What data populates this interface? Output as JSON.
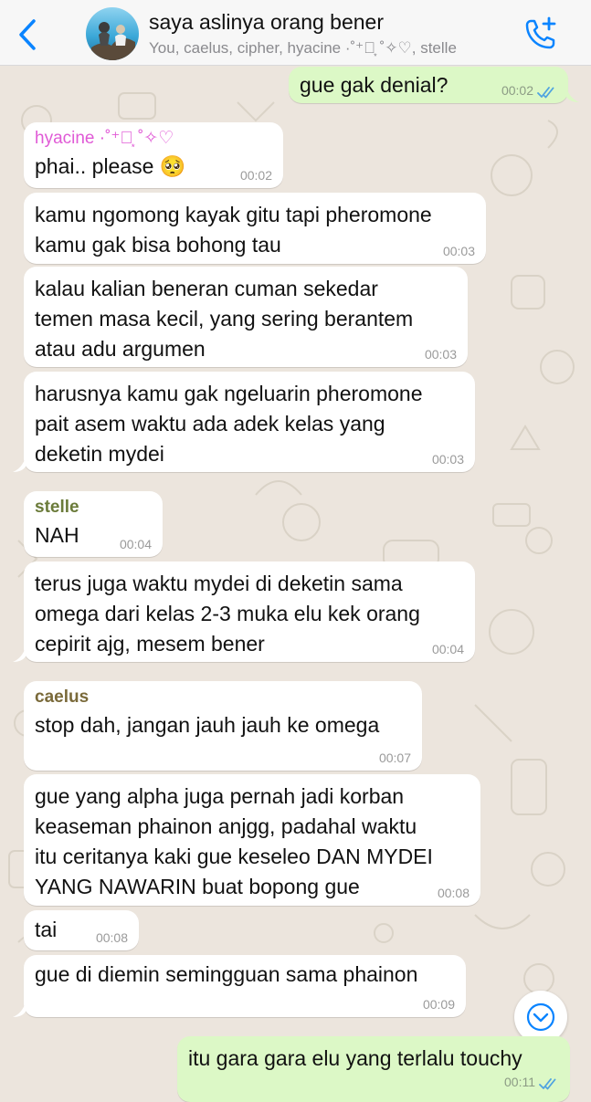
{
  "header": {
    "title": "saya aslinya orang bener",
    "members": "You, caelus, cipher, hyacine ·˚⁺‧͙ ˚✧♡, stelle",
    "back_icon": "chevron-left-icon",
    "call_icon": "add-call-icon",
    "accent": "#0A84FF"
  },
  "messages": [
    {
      "dir": "out",
      "text": "gue gak denial?",
      "time": "00:02",
      "read": true
    },
    {
      "dir": "in",
      "sender": "hyacine ·˚⁺‧͙ ˚✧♡",
      "sender_color": "#E05AD6",
      "text": "phai.. please 🥺",
      "time": "00:02"
    },
    {
      "dir": "in",
      "text": "kamu ngomong kayak gitu tapi pheromone\nkamu gak bisa bohong tau",
      "time": "00:03"
    },
    {
      "dir": "in",
      "text": "kalau kalian beneran cuman sekedar\ntemen masa kecil, yang sering berantem\natau adu argumen",
      "time": "00:03"
    },
    {
      "dir": "in",
      "text": "harusnya kamu gak ngeluarin pheromone\npait asem waktu ada adek kelas yang\ndeketin mydei",
      "time": "00:03"
    },
    {
      "dir": "in",
      "sender": "stelle",
      "sender_color": "#6B7B3A",
      "text": "NAH",
      "time": "00:04"
    },
    {
      "dir": "in",
      "text": "terus juga waktu mydei di deketin sama\nomega dari kelas 2-3 muka elu kek orang\ncepirit ajg, mesem bener",
      "time": "00:04"
    },
    {
      "dir": "in",
      "sender": "caelus",
      "sender_color": "#7A6A3A",
      "text": "stop dah, jangan jauh jauh ke omega",
      "time": "00:07"
    },
    {
      "dir": "in",
      "text": "gue yang alpha juga pernah jadi korban\nkeaseman phainon anjgg, padahal waktu\nitu ceritanya kaki gue keseleo DAN MYDEI\nYANG NAWARIN buat bopong gue",
      "time": "00:08"
    },
    {
      "dir": "in",
      "text": "tai",
      "time": "00:08"
    },
    {
      "dir": "in",
      "text": "gue di diemin semingguan sama phainon",
      "time": "00:09"
    },
    {
      "dir": "out",
      "text": "itu gara gara elu yang terlalu touchy",
      "time": "00:11",
      "read": true
    }
  ],
  "scroll_down_icon": "chevron-down-circle-icon",
  "colors": {
    "wallpaper": "#ECE5DD",
    "incoming_bubble": "#FFFFFF",
    "outgoing_bubble": "#DCF8C6",
    "read_ticks": "#4FA3E0"
  }
}
